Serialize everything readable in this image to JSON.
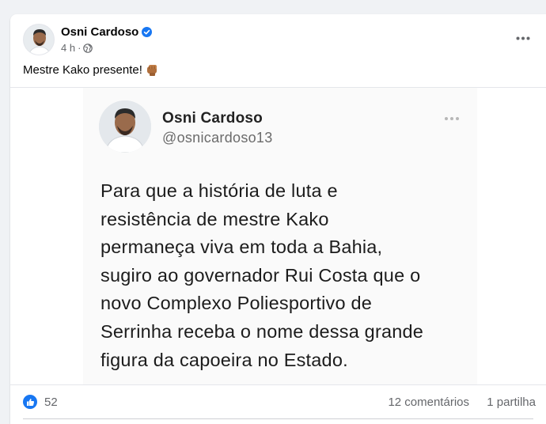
{
  "post": {
    "author": "Osni Cardoso",
    "time": "4 h",
    "text": "Mestre Kako presente!",
    "emoji_icon": "raised-fist-icon"
  },
  "tweet": {
    "name": "Osni Cardoso",
    "handle": "@osnicardoso13",
    "body": "Para que a história de luta e\nresistência de mestre Kako\npermaneça viva em toda a Bahia,\nsugiro ao governador Rui Costa que o\nnovo Complexo Poliesportivo de\nSerrinha receba o nome dessa grande\nfigura da capoeira no Estado."
  },
  "reactions": {
    "count": "52",
    "comments": "12 comentários",
    "shares": "1 partilha"
  },
  "colors": {
    "accent": "#1877f2",
    "secondary_text": "#65676b",
    "background": "#f0f2f5"
  }
}
